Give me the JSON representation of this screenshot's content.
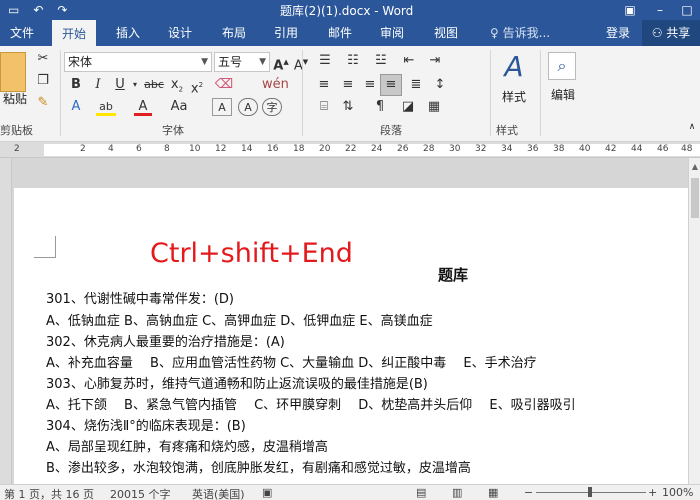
{
  "titlebar": {
    "doc_title": "题库(2)(1).docx - Word"
  },
  "tabs": [
    "文件",
    "开始",
    "插入",
    "设计",
    "布局",
    "引用",
    "邮件",
    "审阅",
    "视图"
  ],
  "tell_me": "告诉我...",
  "login": "登录",
  "share": "共享",
  "ribbon": {
    "paste_label": "粘贴",
    "clipboard_label": "剪贴板",
    "font_name": "宋体",
    "font_size": "五号",
    "font_group_label": "字体",
    "paragraph_group_label": "段落",
    "styles_label": "样式",
    "styles_group_label": "样式",
    "editing_label": "编辑"
  },
  "ruler_numbers": [
    "2",
    "2",
    "4",
    "6",
    "8",
    "10",
    "12",
    "14",
    "16",
    "18",
    "20",
    "22",
    "24",
    "26",
    "28",
    "30",
    "32",
    "34",
    "36",
    "38",
    "40",
    "42",
    "44",
    "46",
    "48"
  ],
  "document": {
    "shortcut_overlay": "Ctrl+shift+End",
    "title": "题库",
    "lines": [
      "301、代谢性碱中毒常伴发：(D)",
      "A、低钠血症 B、高钠血症 C、高钾血症 D、低钾血症 E、高镁血症",
      "302、休克病人最重要的治疗措施是：(A)",
      "A、补充血容量　 B、应用血管活性药物 C、大量输血 D、纠正酸中毒　 E、手术治疗",
      "303、心肺复苏时，维持气道通畅和防止返流误吸的最佳措施是(B)",
      "A、托下颌　 B、紧急气管内插管　 C、环甲膜穿刺　 D、枕垫高并头后仰　 E、吸引器吸引",
      "304、烧伤浅Ⅱ°的临床表现是：(B)",
      "A、局部呈现红肿，有疼痛和烧灼感，皮温稍增高",
      "B、渗出较多，水泡较饱满，创底肿胀发红，有剧痛和感觉过敏，皮温增高"
    ]
  },
  "statusbar": {
    "page": "第 1 页，共 16 页",
    "words": "20015 个字",
    "language": "英语(美国)",
    "zoom": "100%"
  },
  "colors": {
    "word_blue": "#2b579a",
    "shortcut_red": "#e3191c"
  }
}
